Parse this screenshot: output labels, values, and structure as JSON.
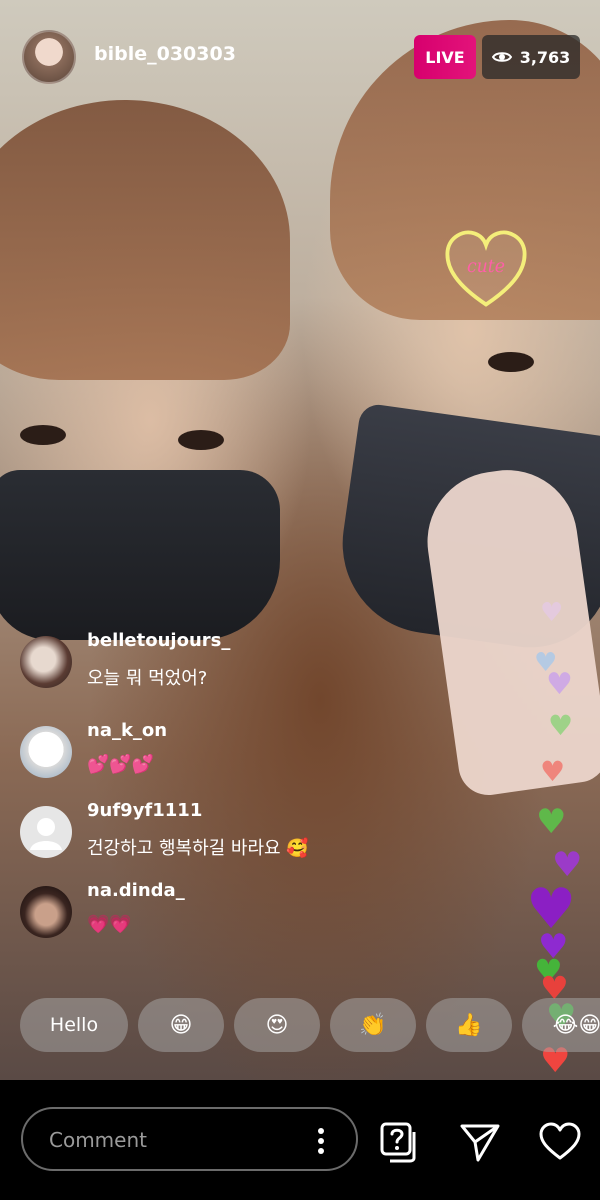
{
  "header": {
    "host_username": "bible_030303",
    "live_label": "LIVE",
    "viewer_count": "3,763"
  },
  "sticker": {
    "text": "cute"
  },
  "comments": [
    {
      "username": "belletoujours_",
      "text": "오늘 뭐 먹었어?"
    },
    {
      "username": "na_k_on",
      "text": "💕💕💕"
    },
    {
      "username": "9uf9yf1111",
      "text": "건강하고 행복하길 바라요 🥰"
    },
    {
      "username": "na.dinda_",
      "text": "💗💗"
    }
  ],
  "quick_reactions": [
    {
      "label": "Hello"
    },
    {
      "label": "😁"
    },
    {
      "label": "😍"
    },
    {
      "label": "👏"
    },
    {
      "label": "👍"
    },
    {
      "label": "😂😁"
    }
  ],
  "composer": {
    "placeholder": "Comment"
  },
  "icons": {
    "viewers": "eye-icon",
    "more": "more-vertical-icon",
    "question": "question-sticker-icon",
    "share": "send-icon",
    "like": "heart-outline-icon"
  },
  "colors": {
    "live": "#d7006e",
    "background": "#000000"
  }
}
